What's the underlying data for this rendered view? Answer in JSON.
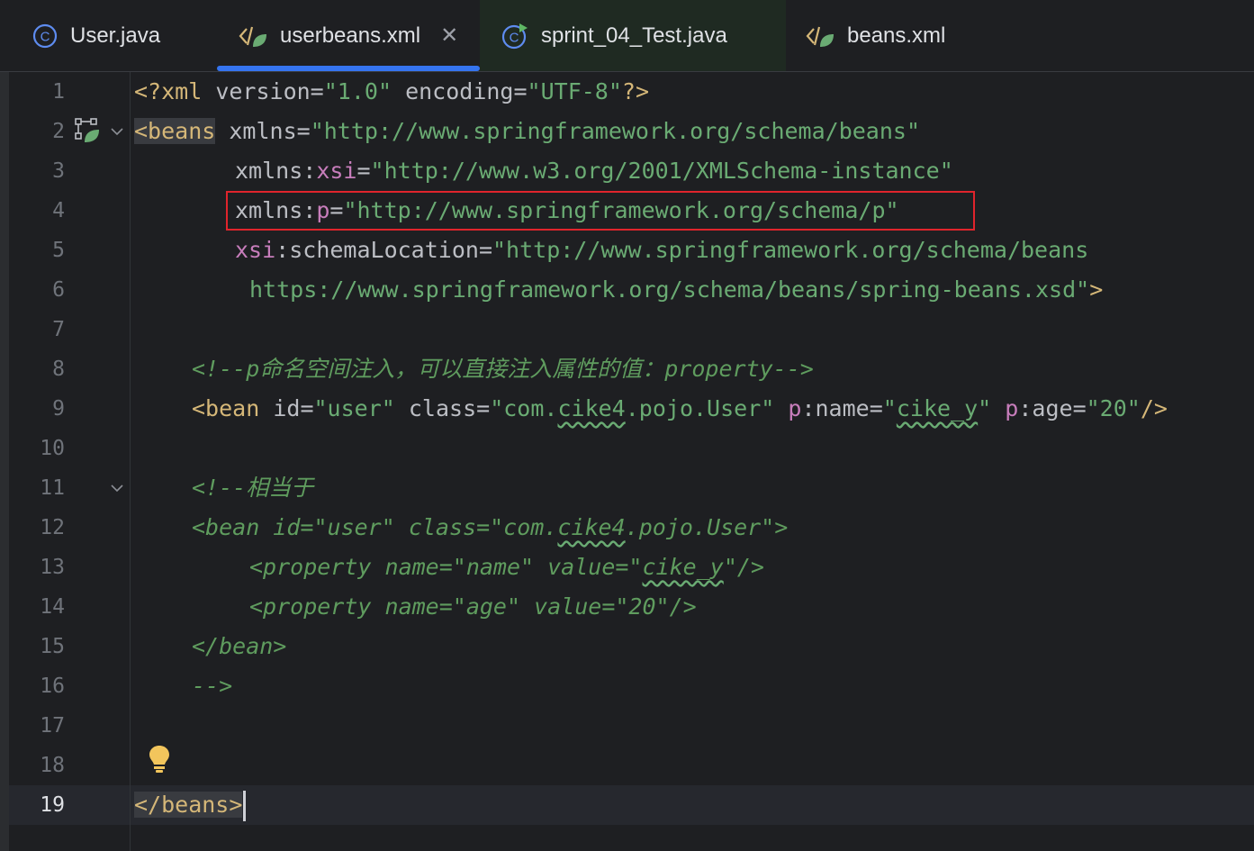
{
  "tabs": [
    {
      "label": "User.java",
      "icon": "java-class-icon"
    },
    {
      "label": "userbeans.xml",
      "icon": "xml-spring-icon",
      "active": true
    },
    {
      "label": "sprint_04_Test.java",
      "icon": "java-test-class-icon"
    },
    {
      "label": "beans.xml",
      "icon": "xml-spring-icon"
    }
  ],
  "close_symbol": "✕",
  "line_numbers": [
    "1",
    "2",
    "3",
    "4",
    "5",
    "6",
    "7",
    "8",
    "9",
    "10",
    "11",
    "12",
    "13",
    "14",
    "15",
    "16",
    "17",
    "18",
    "19"
  ],
  "code": {
    "l1": {
      "open": "<?xml ",
      "a1": "version",
      "eq1": "=",
      "v1": "\"1.0\"",
      "sp": " ",
      "a2": "encoding",
      "eq2": "=",
      "v2": "\"UTF-8\"",
      "close": "?>"
    },
    "l2": {
      "tag": "<beans",
      "sp": " ",
      "attr": "xmlns",
      "eq": "=",
      "val": "\"http://www.springframework.org/schema/beans\""
    },
    "l3": {
      "attr": "xmlns",
      "colon": ":",
      "ns": "xsi",
      "eq": "=",
      "val": "\"http://www.w3.org/2001/XMLSchema-instance\""
    },
    "l4": {
      "attr": "xmlns",
      "colon": ":",
      "ns": "p",
      "eq": "=",
      "val": "\"http://www.springframework.org/schema/p\""
    },
    "l5": {
      "ns": "xsi",
      "colon": ":",
      "attr": "schemaLocation",
      "eq": "=",
      "val": "\"http://www.springframework.org/schema/beans"
    },
    "l6": {
      "val": "https://www.springframework.org/schema/beans/spring-beans.xsd\"",
      "close": ">"
    },
    "l8": {
      "comment": "<!--p命名空间注入，可以直接注入属性的值：property-->"
    },
    "l9": {
      "tag": "<bean",
      "a_id": "id",
      "eq": "=",
      "v_id": "\"user\"",
      "a_class": "class",
      "v_class_pre": "\"com.",
      "v_class_wavy": "cike4",
      "v_class_post": ".pojo.User\"",
      "ns1": "p",
      "colon": ":",
      "a_name": "name",
      "v_name_q": "\"",
      "v_name_wavy": "cike_y",
      "v_name_q2": "\"",
      "ns2": "p",
      "a_age": "age",
      "v_age": "\"20\"",
      "close": "/>"
    },
    "l11": {
      "comment": "<!--相当于"
    },
    "l12": {
      "pre": "<bean id=\"user\" class=\"com.",
      "wavy": "cike4",
      "post": ".pojo.User\">"
    },
    "l13": {
      "pre": "<property name=\"name\" value=\"",
      "wavy": "cike_y",
      "post": "\"/>"
    },
    "l14": {
      "text": "<property name=\"age\" value=\"20\"/>"
    },
    "l15": {
      "text": "</bean>"
    },
    "l16": {
      "text": "-->"
    },
    "l19": {
      "text": "</beans>"
    }
  },
  "colors": {
    "background": "#1e1f22",
    "tag": "#d5b778",
    "attribute_value": "#6aab73",
    "namespace": "#c77dbb",
    "comment": "#5f9c5e",
    "accent": "#3574f0",
    "highlight_box": "#e0242c"
  }
}
